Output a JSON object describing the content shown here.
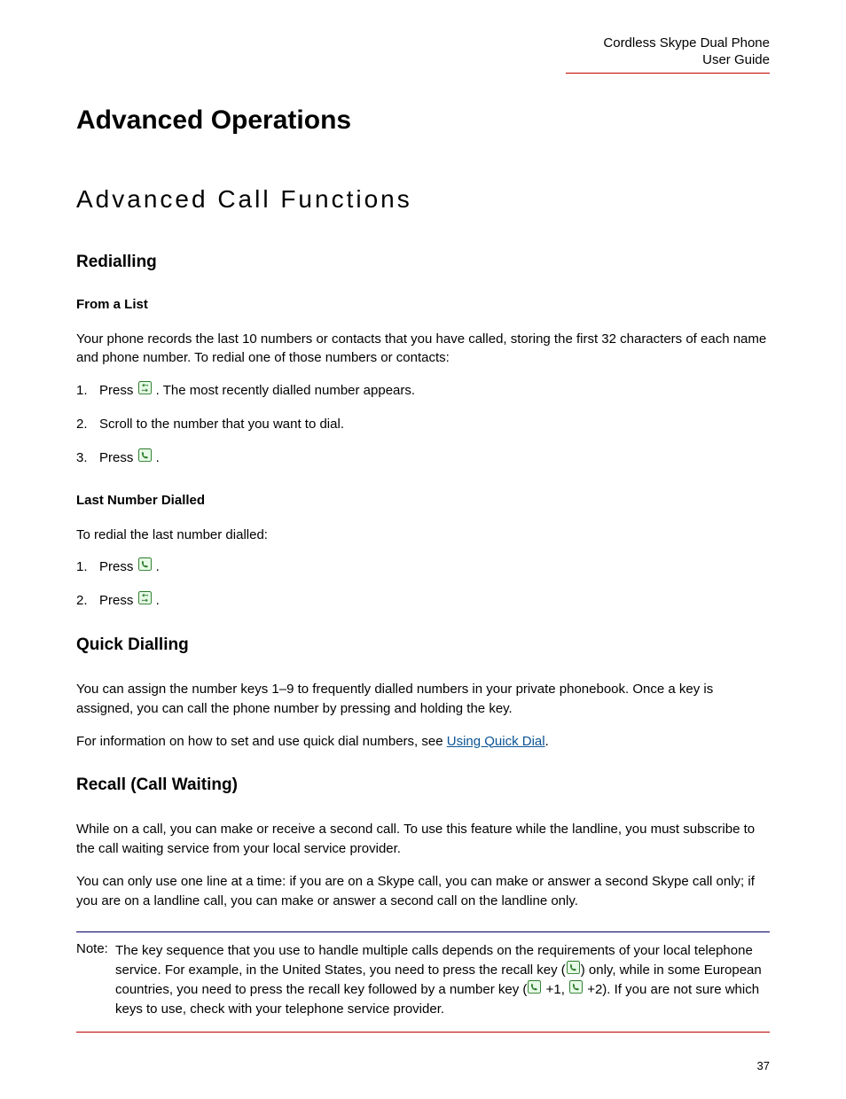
{
  "header": {
    "line1": "Cordless Skype Dual Phone",
    "line2": "User Guide"
  },
  "h1": "Advanced Operations",
  "h2": "Advanced Call Functions",
  "sections": {
    "redialling": {
      "title": "Redialling",
      "fromList": {
        "title": "From a List",
        "intro": "Your phone records the last 10 numbers or contacts that you have called, storing the first 32 characters of each name and phone number. To redial one of those numbers or contacts:",
        "step1_pre": "Press ",
        "step1_post": " . The most recently dialled number appears.",
        "step2": "Scroll to the number that you want to dial.",
        "step3_pre": "Press ",
        "step3_post": " ."
      },
      "lastNumber": {
        "title": "Last Number Dialled",
        "intro": "To redial the last number dialled:",
        "step1_pre": "Press ",
        "step1_post": " .",
        "step2_pre": "Press ",
        "step2_post": " ."
      }
    },
    "quickDialling": {
      "title": "Quick Dialling",
      "p1": "You can assign the number keys 1–9 to frequently dialled numbers in your private phonebook. Once a key is assigned, you can call the phone number by pressing and holding the key.",
      "p2_pre": "For information on how to set and use quick dial numbers, see ",
      "link_text": "Using Quick Dial",
      "p2_post": "."
    },
    "recall": {
      "title": "Recall (Call Waiting)",
      "p1": "While on a call, you can make or receive a second call. To use this feature while the landline, you must subscribe to the call waiting service from your local service provider.",
      "p2": "You can only use one line at a time: if you are on a Skype call, you can make or answer a second Skype call only; if you are on a landline call, you can make or answer a second call on the landline only.",
      "note_label": "Note:",
      "note_seg1": "The key sequence that you use to handle multiple calls depends on the requirements of your local telephone service. For example, in the United States, you need to press the recall key (",
      "note_seg2": ") only, while in some European countries, you need to press the recall key followed by a number key (",
      "note_seg3": " +1, ",
      "note_seg4": " +2). If you are not sure which keys to use, check with your telephone service provider."
    }
  },
  "icons": {
    "redial_key": "redial-key",
    "call_key": "call-key"
  },
  "page_number": "37"
}
